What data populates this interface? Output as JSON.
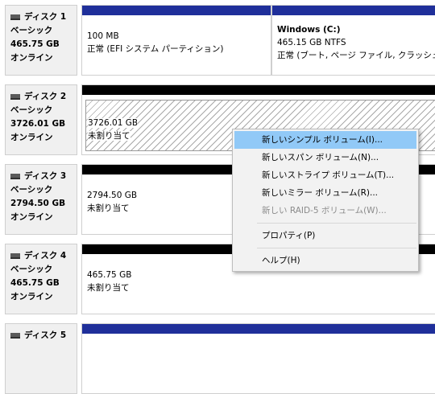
{
  "disks": [
    {
      "name": "ディスク 1",
      "type": "ベーシック",
      "size": "465.75 GB",
      "status": "オンライン",
      "partitions": [
        {
          "name": "",
          "line1": "100 MB",
          "line2": "正常 (EFI システム パーティション)"
        },
        {
          "name": "Windows  (C:)",
          "line1": "465.15 GB NTFS",
          "line2": "正常 (ブート, ページ ファイル, クラッシュ ダン"
        }
      ]
    },
    {
      "name": "ディスク 2",
      "type": "ベーシック",
      "size": "3726.01 GB",
      "status": "オンライン",
      "partitions": [
        {
          "line1": "3726.01 GB",
          "line2": "未割り当て"
        }
      ]
    },
    {
      "name": "ディスク 3",
      "type": "ベーシック",
      "size": "2794.50 GB",
      "status": "オンライン",
      "partitions": [
        {
          "line1": "2794.50 GB",
          "line2": "未割り当て"
        }
      ]
    },
    {
      "name": "ディスク 4",
      "type": "ベーシック",
      "size": "465.75 GB",
      "status": "オンライン",
      "partitions": [
        {
          "line1": "465.75 GB",
          "line2": "未割り当て"
        }
      ]
    },
    {
      "name": "ディスク 5"
    }
  ],
  "context_menu": {
    "items": [
      "新しいシンプル ボリューム(I)...",
      "新しいスパン ボリューム(N)...",
      "新しいストライプ ボリューム(T)...",
      "新しいミラー ボリューム(R)...",
      "新しい RAID-5 ボリューム(W)...",
      "プロパティ(P)",
      "ヘルプ(H)"
    ]
  },
  "colors": {
    "primary_bar": "#1f2f9a",
    "unallocated_bar": "#000000",
    "menu_highlight": "#91c9f7"
  }
}
